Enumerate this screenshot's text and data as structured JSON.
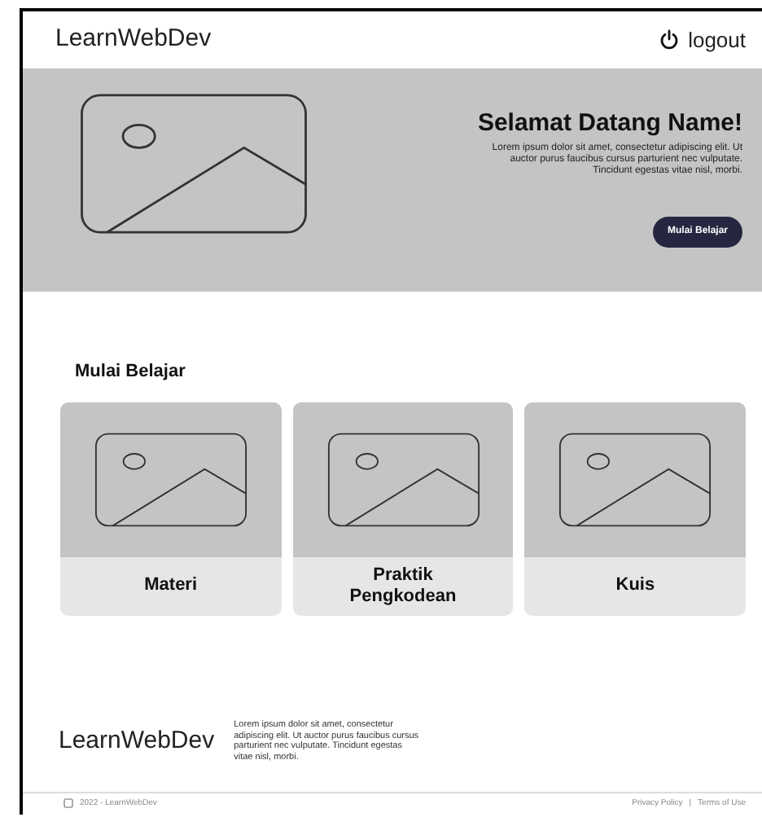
{
  "navbar": {
    "brand": "LearnWebDev",
    "logout": "logout"
  },
  "hero": {
    "title": "Selamat Datang Name!",
    "text": "Lorem ipsum dolor sit amet, consectetur adipiscing elit. Ut auctor purus faucibus cursus parturient nec vulputate. Tincidunt egestas vitae nisl, morbi.",
    "button": "Mulai Belajar"
  },
  "section": {
    "title": "Mulai Belajar",
    "cards": [
      {
        "label": "Materi"
      },
      {
        "label": "Praktik Pengkodean"
      },
      {
        "label": "Kuis"
      }
    ]
  },
  "footer": {
    "brand": "LearnWebDev",
    "text": "Lorem ipsum dolor sit amet, consectetur adipiscing elit. Ut auctor purus faucibus cursus parturient nec vulputate. Tincidunt egestas vitae nisl, morbi.",
    "copyright": "2022 - LearnWebDev",
    "links": [
      "Privacy Policy",
      "Terms of Use"
    ],
    "separator": "|"
  }
}
